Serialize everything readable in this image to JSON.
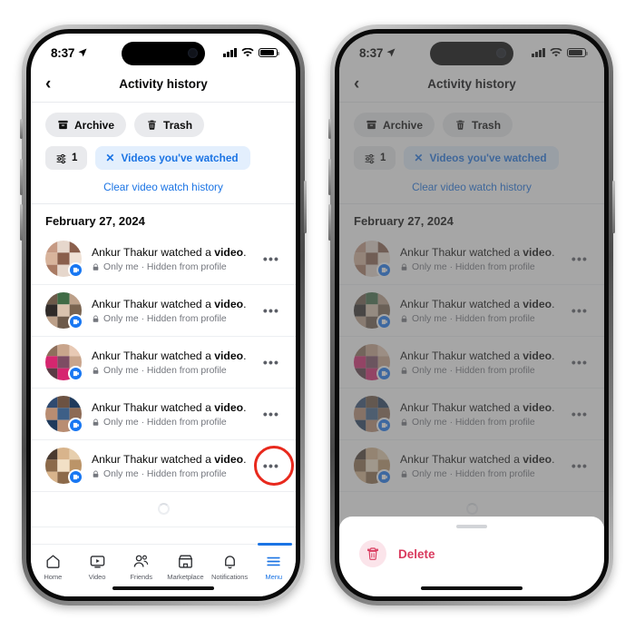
{
  "status_bar": {
    "time": "8:37",
    "location_icon": "location-arrow-icon",
    "signal_icon": "cellular-signal-icon",
    "wifi_icon": "wifi-icon",
    "battery_icon": "battery-icon"
  },
  "header": {
    "back_icon": "back-chevron-icon",
    "title": "Activity history"
  },
  "chips": [
    {
      "label": "Archive",
      "icon": "archive-box-icon"
    },
    {
      "label": "Trash",
      "icon": "trash-can-icon"
    }
  ],
  "filters": {
    "count_icon": "sliders-filter-icon",
    "count": "1",
    "active_filter_label": "Videos you've watched",
    "active_filter_close_icon": "close-x-icon",
    "clear_link": "Clear video watch history"
  },
  "date_header": "February 27, 2024",
  "activity": {
    "privacy_icon": "lock-icon",
    "menu_icon": "three-dots-icon",
    "video_badge_icon": "video-badge-icon",
    "rows": [
      {
        "title_prefix": "Ankur Thakur watched a ",
        "title_bold": "video",
        "title_suffix": ".",
        "meta": "Only me · Hidden from profile",
        "thumb_colors": [
          "#c69a84",
          "#e6d7cc",
          "#8a5f4c",
          "#d8b49c",
          "#f0e2d6",
          "#a97a63"
        ]
      },
      {
        "title_prefix": "Ankur Thakur watched a ",
        "title_bold": "video",
        "title_suffix": ".",
        "meta": "Only me · Hidden from profile",
        "thumb_colors": [
          "#6d5a4a",
          "#3f6b45",
          "#bca089",
          "#2f2a28",
          "#d9c3ae",
          "#7a6450"
        ]
      },
      {
        "title_prefix": "Ankur Thakur watched a ",
        "title_bold": "video",
        "title_suffix": ".",
        "meta": "Only me · Hidden from profile",
        "thumb_colors": [
          "#8e6f5c",
          "#d6266f",
          "#c9a58c",
          "#7d4c63",
          "#e8c9b4",
          "#5b3b45"
        ]
      },
      {
        "title_prefix": "Ankur Thakur watched a ",
        "title_bold": "video",
        "title_suffix": ".",
        "meta": "Only me · Hidden from profile",
        "thumb_colors": [
          "#2f4a70",
          "#6c5242",
          "#1f3a5c",
          "#b98d72",
          "#3d5f87",
          "#8d6b55"
        ]
      },
      {
        "title_prefix": "Ankur Thakur watched a ",
        "title_bold": "video",
        "title_suffix": ".",
        "meta": "Only me · Hidden from profile",
        "thumb_colors": [
          "#d8b48c",
          "#4a3a30",
          "#e7cfae",
          "#bb9468",
          "#f2e0c6",
          "#8c6a4a"
        ]
      }
    ],
    "loading_spinner": "loading-spinner-icon"
  },
  "annotation": {
    "highlight_color": "#e8291d",
    "target": "three-dots-icon"
  },
  "bottom_nav": {
    "items": [
      {
        "label": "Home",
        "icon": "home-icon",
        "active": false
      },
      {
        "label": "Video",
        "icon": "video-icon",
        "active": false
      },
      {
        "label": "Friends",
        "icon": "friends-icon",
        "active": false
      },
      {
        "label": "Marketplace",
        "icon": "marketplace-icon",
        "active": false
      },
      {
        "label": "Notifications",
        "icon": "bell-icon",
        "active": false
      },
      {
        "label": "Menu",
        "icon": "hamburger-menu-icon",
        "active": true
      }
    ]
  },
  "action_sheet": {
    "handle": "sheet-drag-handle",
    "delete_label": "Delete",
    "delete_icon": "trash-can-icon",
    "delete_color": "#d93a5e"
  },
  "theme": {
    "accent_blue": "#1b74e4",
    "badge_blue": "#1877f2",
    "chip_gray": "#e9eaed",
    "filter_blue_bg": "#e3effd",
    "scrim": "rgba(92,92,92,0.55)"
  }
}
